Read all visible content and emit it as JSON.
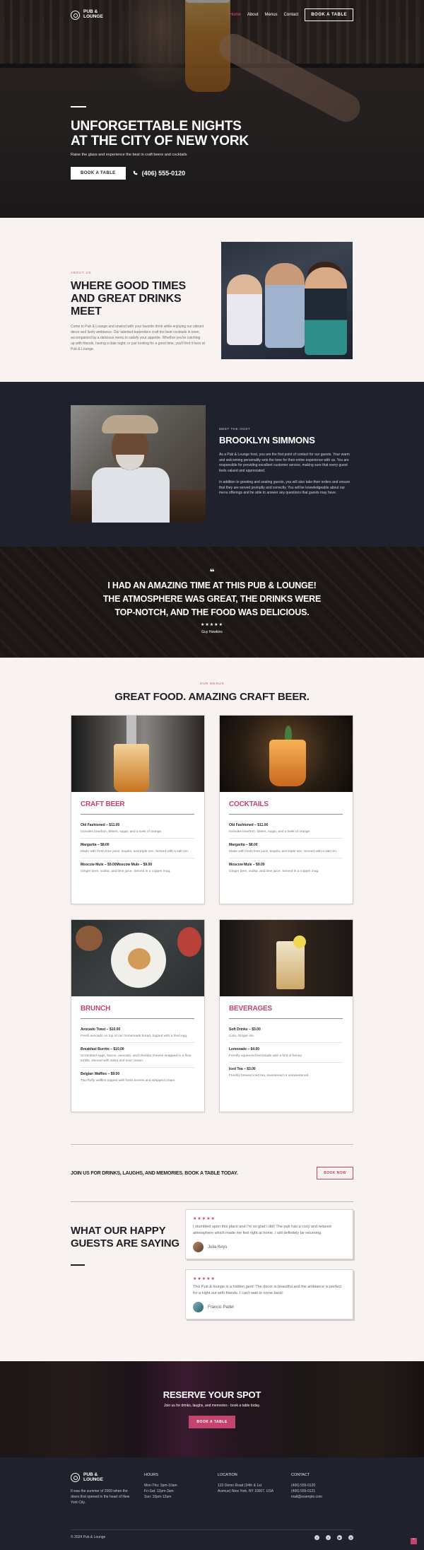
{
  "brand": {
    "name_line1": "PUB &",
    "name_line2": "LOUNGE",
    "accent": "#c2446f"
  },
  "nav": {
    "items": [
      {
        "label": "Home",
        "active": true
      },
      {
        "label": "About",
        "active": false
      },
      {
        "label": "Menus",
        "active": false
      },
      {
        "label": "Contact",
        "active": false
      }
    ],
    "cta": "BOOK A TABLE"
  },
  "hero": {
    "title": "UNFORGETTABLE NIGHTS AT THE CITY OF NEW YORK",
    "subtitle": "Raise the glass and experience the best in craft beers and cocktails",
    "button": "BOOK A TABLE",
    "phone": "(406) 555-0120"
  },
  "about": {
    "eyebrow": "ABOUT US",
    "title": "WHERE GOOD TIMES AND GREAT DRINKS MEET",
    "text": "Come to Pub & Lounge and unwind with your favorite drink while enjoying our vibrant decor and lively ambiance. Our talented bartenders craft the best cocktails in town, accompanied by a delicious menu to satisfy your appetite. Whether you're catching up with friends, having a date night, or just looking for a good time, you'll find it here at Pub & Lounge."
  },
  "host": {
    "eyebrow": "MEET THE HOST",
    "name": "BROOKLYN SIMMONS",
    "p1": "As a Pub & Lounge host, you are the first point of contact for our guests. Your warm and welcoming personality sets the tone for their entire experience with us. You are responsible for providing excellent customer service, making sure that every guest feels valued and appreciated.",
    "p2": "In addition to greeting and seating guests, you will also take their orders and ensure that they are served promptly and correctly. You will be knowledgeable about our menu offerings and be able to answer any questions that guests may have."
  },
  "testimonial": {
    "mark": "❝",
    "text": "I HAD AN AMAZING TIME AT THIS PUB & LOUNGE! THE ATMOSPHERE WAS GREAT, THE DRINKS WERE TOP-NOTCH, AND THE FOOD WAS DELICIOUS.",
    "stars": "★★★★★",
    "author": "Guy Hawkins"
  },
  "menus": {
    "eyebrow": "OUR MENUS",
    "title": "GREAT FOOD. AMAZING CRAFT BEER.",
    "cards": [
      {
        "title": "CRAFT BEER",
        "items": [
          {
            "name": "Old Fashioned – $11.00",
            "desc": "Includes bourbon, bitters, sugar, and a twist of orange."
          },
          {
            "name": "Margarita – $8.00",
            "desc": "Made with fresh lime juice, tequila, and triple sec. Served with a salt rim."
          },
          {
            "name": "Moscow Mule – $9.00Moscow Mule – $9.00",
            "desc": "Ginger beer, vodka, and lime juice. Served in a copper mug."
          }
        ]
      },
      {
        "title": "COCKTAILS",
        "items": [
          {
            "name": "Old Fashioned – $11.00",
            "desc": "Includes bourbon, bitters, sugar, and a twist of orange."
          },
          {
            "name": "Margarita – $8.00",
            "desc": "Made with fresh lime juice, tequila, and triple sec. Served with a salt rim."
          },
          {
            "name": "Moscow Mule – $9.00",
            "desc": "Ginger beer, vodka, and lime juice. Served in a copper mug."
          }
        ]
      },
      {
        "title": "BRUNCH",
        "items": [
          {
            "name": "Avocado Toast – $10.00",
            "desc": "Fresh avocado on top of our homemade bread, topped with a fried egg."
          },
          {
            "name": "Breakfast Burrito – $10.00",
            "desc": "Scrambled eggs, bacon, avocado, and cheddar cheese wrapped in a flour tortilla. Served with salsa and sour cream."
          },
          {
            "name": "Belgian Waffles – $9.00",
            "desc": "Two fluffy waffles topped with fresh berries and whipped cream."
          }
        ]
      },
      {
        "title": "BEVERAGES",
        "items": [
          {
            "name": "Soft Drinks – $3.00",
            "desc": "Cola, Ginger Ale."
          },
          {
            "name": "Lemonade – $4.00",
            "desc": "Freshly squeezed lemonade with a hint of honey."
          },
          {
            "name": "Iced Tea – $3.00",
            "desc": "Freshly brewed iced tea, sweetened or unsweetened."
          }
        ]
      }
    ]
  },
  "cta_strip": {
    "text": "JOIN US FOR DRINKS, LAUGHS, AND MEMORIES. BOOK A TABLE TODAY.",
    "button": "BOOK NOW"
  },
  "reviews": {
    "title": "WHAT OUR HAPPY GUESTS ARE SAYING",
    "items": [
      {
        "stars": "★★★★★",
        "text": "I stumbled upon this place and I'm so glad I did! The pub has a cozy and relaxed atmosphere which made me feel right at home. I will definitely be returning.",
        "author": "Julia Keys"
      },
      {
        "stars": "★★★★★",
        "text": "This Pub & lounge is a hidden gem! The decor is beautiful and the ambiance is perfect for a night out with friends. I can't wait to come back!",
        "author": "Francis Padel"
      }
    ]
  },
  "reserve": {
    "title": "RESERVE YOUR SPOT",
    "subtitle": "Join us for drinks, laughs, and memories - book a table today.",
    "button": "BOOK A TABLE"
  },
  "footer": {
    "about": "It was the summer of 2009 when the doors first opened in the heart of New York City.",
    "hours_title": "HOURS",
    "hours": [
      "Mon-Thu: 3pm-10am",
      "Fri-Sat: 12pm-3am",
      "Sun: 10pm-12am"
    ],
    "location_title": "LOCATION",
    "location": [
      "123 Demo Road (34th & 1st",
      "Avenue) New York, NY 10007, USA"
    ],
    "contact_title": "CONTACT",
    "contact": [
      "(406) 555-0120",
      "(406) 555-0121",
      "mail@example.com"
    ],
    "copyright": "© 2024 Pub & Lounge",
    "social": [
      "facebook-icon",
      "twitter-icon",
      "youtube-icon",
      "instagram-icon"
    ]
  }
}
